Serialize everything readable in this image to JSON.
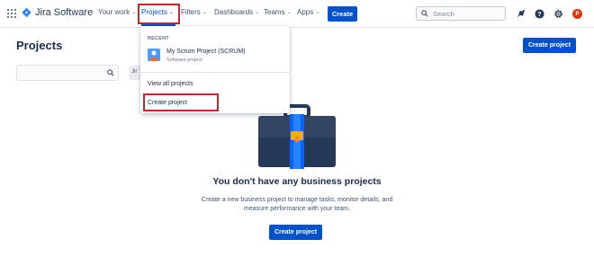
{
  "colors": {
    "brand": "#0052cc",
    "highlight": "#c0262c",
    "avatar": "#de350b"
  },
  "header": {
    "logo_text": "Jira Software",
    "nav": [
      {
        "label": "Your work"
      },
      {
        "label": "Projects"
      },
      {
        "label": "Filters"
      },
      {
        "label": "Dashboards"
      },
      {
        "label": "Teams"
      },
      {
        "label": "Apps"
      }
    ],
    "create_label": "Create",
    "search_placeholder": "Search",
    "icons": [
      "notifications-icon",
      "help-icon",
      "settings-icon"
    ],
    "avatar_initial": "P"
  },
  "page": {
    "title": "Projects",
    "create_project_label": "Create project",
    "category_stub": "Jir"
  },
  "dropdown": {
    "section_label": "RECENT",
    "recent_project": {
      "name": "My Scrum Project (SCRUM)",
      "type": "Software project"
    },
    "view_all_label": "View all projects",
    "create_project_label": "Create project"
  },
  "empty_state": {
    "title": "You don't have any business projects",
    "description": "Create a new business project to manage tasks, monitor details, and measure performance with your team.",
    "button_label": "Create project"
  }
}
